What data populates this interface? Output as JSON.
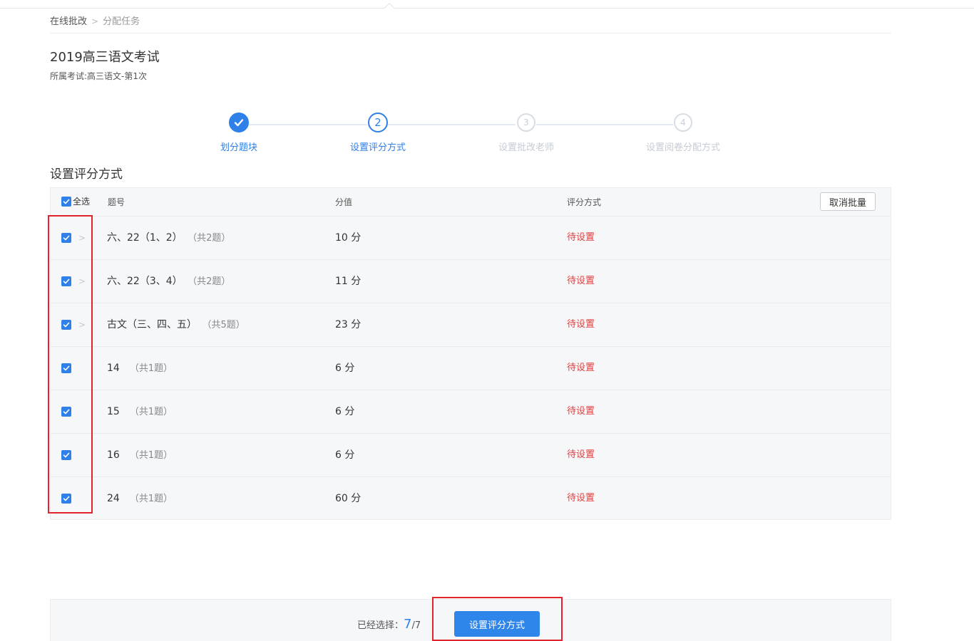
{
  "breadcrumb": [
    "在线批改",
    "分配任务"
  ],
  "page": {
    "title": "2019高三语文考试",
    "subtitle": "所属考试:高三语文-第1次"
  },
  "steps": [
    {
      "number": "",
      "label": "划分题块",
      "state": "done"
    },
    {
      "number": "2",
      "label": "设置评分方式",
      "state": "active"
    },
    {
      "number": "3",
      "label": "设置批改老师",
      "state": "pending"
    },
    {
      "number": "4",
      "label": "设置阅卷分配方式",
      "state": "pending"
    }
  ],
  "section_title": "设置评分方式",
  "table": {
    "select_all_label": "全选",
    "columns": {
      "question": "题号",
      "score": "分值",
      "method": "评分方式"
    },
    "cancel_batch_label": "取消批量",
    "rows": [
      {
        "name": "六、22（1、2）",
        "count": "（共2题）",
        "score": "10 分",
        "status": "待设置",
        "expandable": true,
        "checked": true
      },
      {
        "name": "六、22（3、4）",
        "count": "（共2题）",
        "score": "11 分",
        "status": "待设置",
        "expandable": true,
        "checked": true
      },
      {
        "name": "古文（三、四、五）",
        "count": "（共5题）",
        "score": "23 分",
        "status": "待设置",
        "expandable": true,
        "checked": true
      },
      {
        "name": "14",
        "count": "（共1题）",
        "score": "6 分",
        "status": "待设置",
        "expandable": false,
        "checked": true
      },
      {
        "name": "15",
        "count": "（共1题）",
        "score": "6 分",
        "status": "待设置",
        "expandable": false,
        "checked": true
      },
      {
        "name": "16",
        "count": "（共1题）",
        "score": "6 分",
        "status": "待设置",
        "expandable": false,
        "checked": true
      },
      {
        "name": "24",
        "count": "（共1题）",
        "score": "60 分",
        "status": "待设置",
        "expandable": false,
        "checked": true
      }
    ]
  },
  "footer": {
    "selected_label": "已经选择：",
    "selected_count": "7",
    "total": "/7",
    "button_label": "设置评分方式"
  },
  "colors": {
    "accent": "#2f80e8",
    "danger": "#e33e3e",
    "highlight": "#e1232b"
  }
}
